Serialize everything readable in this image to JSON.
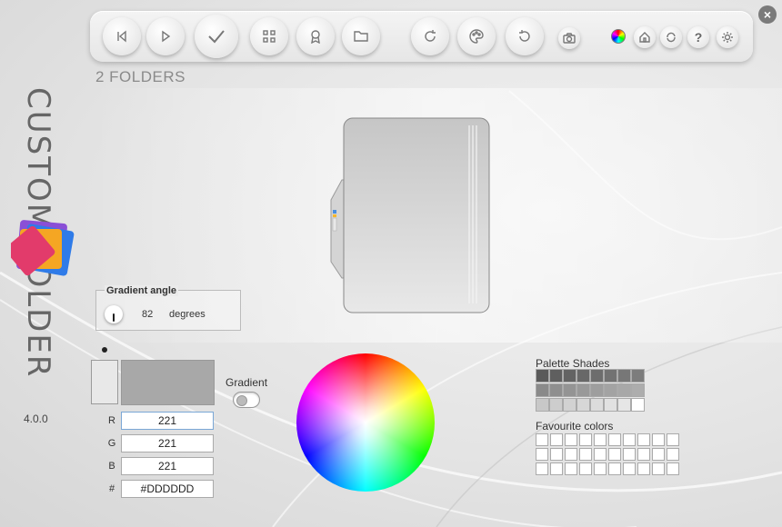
{
  "app": {
    "title": "CUSTOM FOLDER",
    "version": "4.0.0"
  },
  "header": {
    "folders_count": "2 FOLDERS"
  },
  "toolbar": {
    "buttons": [
      {
        "name": "previous-button",
        "icon": "skip-back-icon"
      },
      {
        "name": "play-button",
        "icon": "play-icon"
      },
      {
        "name": "apply-button",
        "icon": "checkmark-icon"
      },
      {
        "name": "grid-button",
        "icon": "grid-icon"
      },
      {
        "name": "badge-button",
        "icon": "award-icon"
      },
      {
        "name": "folder-button",
        "icon": "folder-icon"
      },
      {
        "name": "refresh-button",
        "icon": "refresh-icon"
      },
      {
        "name": "palette-button",
        "icon": "palette-icon"
      },
      {
        "name": "undo-button",
        "icon": "undo-icon"
      },
      {
        "name": "screenshot-button",
        "icon": "camera-icon"
      },
      {
        "name": "color-mode-button",
        "icon": "color-wheel-icon"
      },
      {
        "name": "home-button",
        "icon": "home-icon"
      },
      {
        "name": "sync-button",
        "icon": "sync-icon"
      },
      {
        "name": "help-button",
        "icon": "question-icon"
      },
      {
        "name": "settings-button",
        "icon": "gear-icon"
      }
    ]
  },
  "gradient_angle": {
    "label": "Gradient angle",
    "value": "82",
    "unit": "degrees"
  },
  "color": {
    "r_label": "R",
    "g_label": "G",
    "b_label": "B",
    "hex_label": "#",
    "r": "221",
    "g": "221",
    "b": "221",
    "hex": "#DDDDDD",
    "current": "#dddddd"
  },
  "gradient": {
    "label": "Gradient",
    "enabled": false
  },
  "palette": {
    "shades_label": "Palette Shades",
    "favourites_label": "Favourite colors",
    "shades": [
      "#5a5a5a",
      "#5f5f5f",
      "#636363",
      "#686868",
      "#6d6d6d",
      "#727272",
      "#777777",
      "#7c7c7c",
      "#8a8a8a",
      "#8f8f8f",
      "#949494",
      "#999999",
      "#9e9e9e",
      "#a3a3a3",
      "#a8a8a8",
      "#adadad",
      "#c8c8c8",
      "#cdcdcd",
      "#d2d2d2",
      "#d7d7d7",
      "#dcdcdc",
      "#e1e1e1",
      "#e6e6e6",
      "#ffffff"
    ],
    "favourites_count": 30
  }
}
